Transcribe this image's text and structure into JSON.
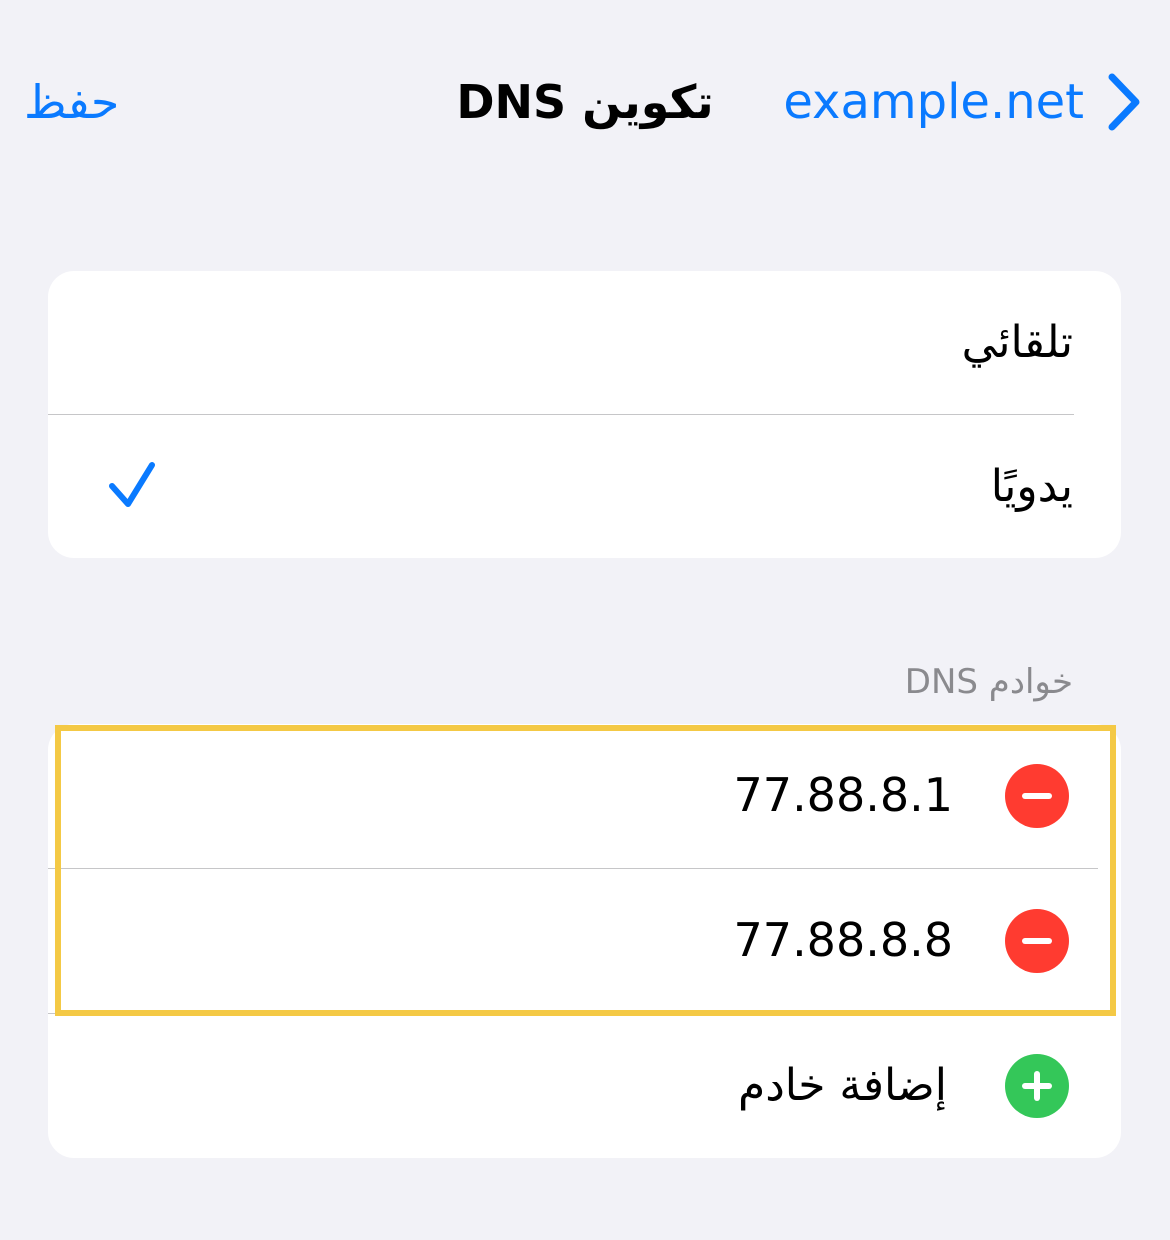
{
  "nav": {
    "title": "تكوين DNS",
    "back_label": "example.net",
    "save_label": "حفظ"
  },
  "mode": {
    "options": [
      {
        "label": "تلقائي",
        "selected": false
      },
      {
        "label": "يدويًا",
        "selected": true
      }
    ]
  },
  "servers": {
    "header": "خوادم DNS",
    "items": [
      {
        "address": "77.88.8.1"
      },
      {
        "address": "77.88.8.8"
      }
    ],
    "add_label": "إضافة خادم"
  },
  "colors": {
    "accent": "#0a7aff",
    "remove": "#ff3b30",
    "add": "#34c759",
    "highlight": "#f4c945",
    "background": "#f2f2f7"
  },
  "icons": {
    "back": "chevron-right-icon",
    "selected": "checkmark-icon",
    "remove": "minus-circle-icon",
    "add": "plus-circle-icon"
  }
}
